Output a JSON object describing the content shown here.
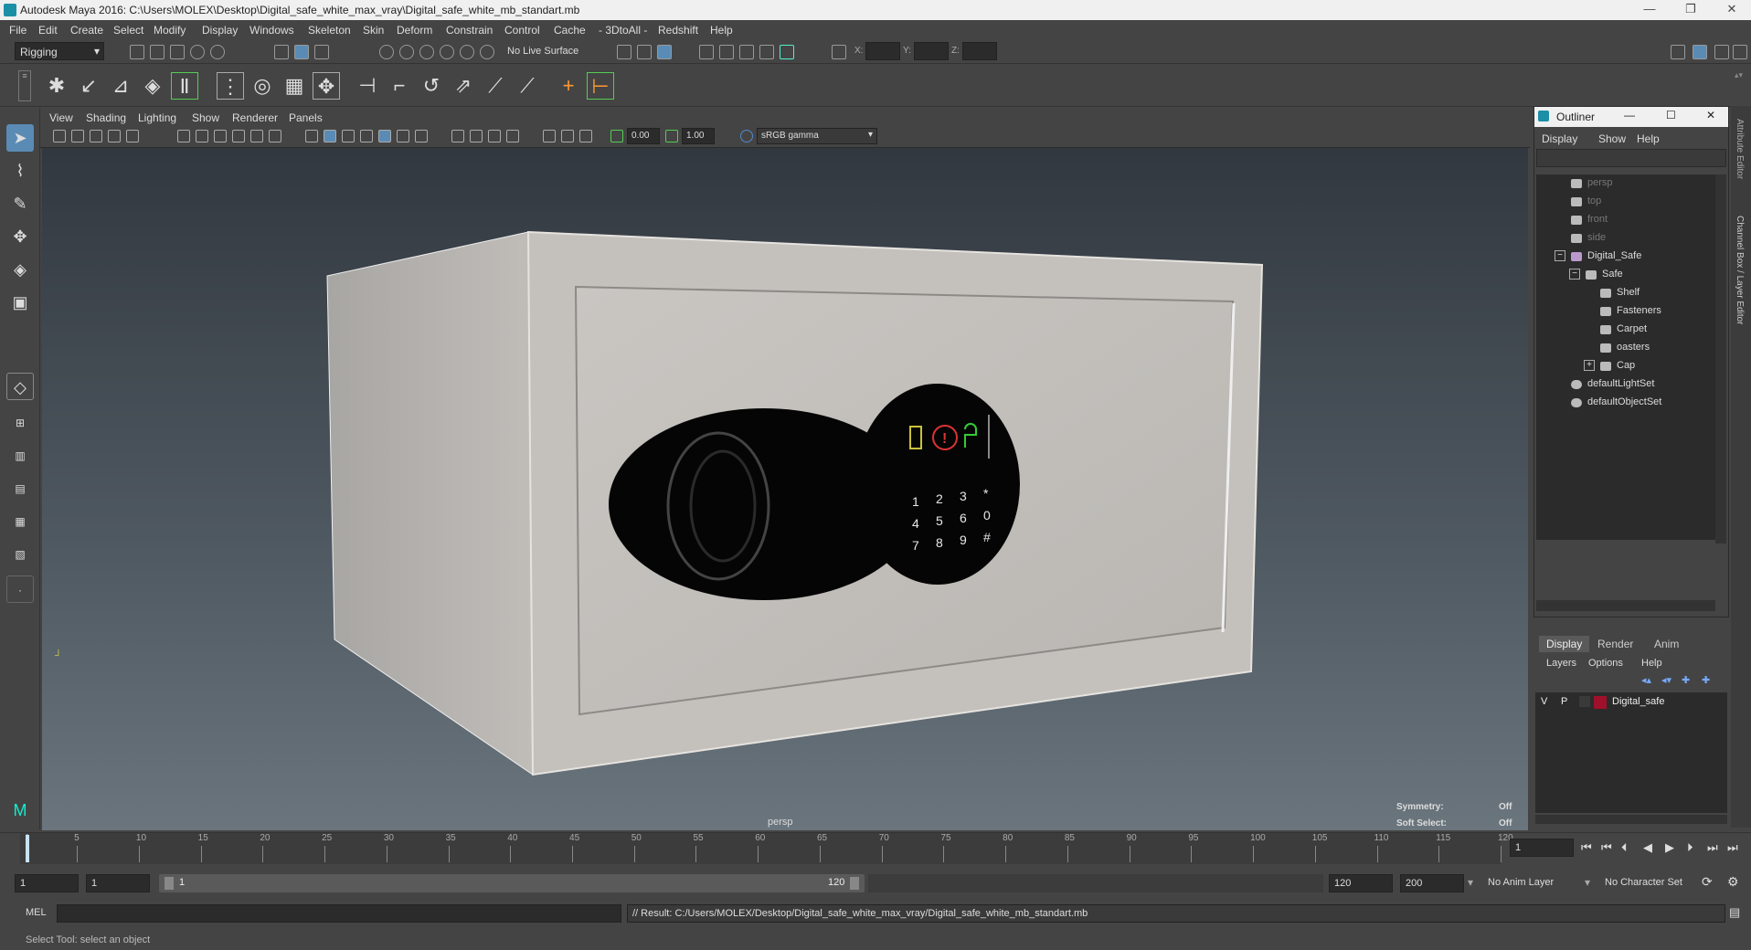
{
  "window": {
    "title": "Autodesk Maya 2016: C:\\Users\\MOLEX\\Desktop\\Digital_safe_white_max_vray\\Digital_safe_white_mb_standart.mb",
    "controls": [
      "—",
      "❐",
      "✕"
    ]
  },
  "menu": [
    "File",
    "Edit",
    "Create",
    "Select",
    "Modify",
    "Display",
    "Windows",
    "Skeleton",
    "Skin",
    "Deform",
    "Constrain",
    "Control",
    "Cache",
    "- 3DtoAll -",
    "Redshift",
    "Help"
  ],
  "toolbar": {
    "mode": "Rigging",
    "live_surface": "No Live Surface",
    "x_label": "X:",
    "y_label": "Y:",
    "z_label": "Z:"
  },
  "panel_menu": [
    "View",
    "Shading",
    "Lighting",
    "Show",
    "Renderer",
    "Panels"
  ],
  "panel_toolbar": {
    "gamma_value1": "0.00",
    "gamma_value2": "1.00",
    "colorspace": "sRGB gamma"
  },
  "viewport": {
    "camera": "persp",
    "symmetry_label": "Symmetry:",
    "symmetry_value": "Off",
    "soft_select_label": "Soft Select:",
    "soft_select_value": "Off",
    "keypad": [
      "1",
      "2",
      "3",
      "*",
      "4",
      "5",
      "6",
      "0",
      "7",
      "8",
      "9",
      "#"
    ]
  },
  "outliner": {
    "title": "Outliner",
    "menu": [
      "Display",
      "Show",
      "Help"
    ],
    "items": [
      {
        "label": "persp",
        "dim": true,
        "indent": 0,
        "icon": "camera-icon"
      },
      {
        "label": "top",
        "dim": true,
        "indent": 0,
        "icon": "camera-icon"
      },
      {
        "label": "front",
        "dim": true,
        "indent": 0,
        "icon": "camera-icon"
      },
      {
        "label": "side",
        "dim": true,
        "indent": 0,
        "icon": "camera-icon"
      },
      {
        "label": "Digital_Safe",
        "dim": false,
        "indent": 0,
        "icon": "joint-icon",
        "expander": "−"
      },
      {
        "label": "Safe",
        "dim": false,
        "indent": 1,
        "icon": "group-icon",
        "expander": "−"
      },
      {
        "label": "Shelf",
        "dim": false,
        "indent": 2,
        "icon": "mesh-icon"
      },
      {
        "label": "Fasteners",
        "dim": false,
        "indent": 2,
        "icon": "mesh-icon"
      },
      {
        "label": "Carpet",
        "dim": false,
        "indent": 2,
        "icon": "mesh-icon"
      },
      {
        "label": "oasters",
        "dim": false,
        "indent": 2,
        "icon": "mesh-icon"
      },
      {
        "label": "Cap",
        "dim": false,
        "indent": 2,
        "icon": "mesh-icon",
        "expander": "+"
      },
      {
        "label": "defaultLightSet",
        "dim": false,
        "indent": 0,
        "icon": "set-icon"
      },
      {
        "label": "defaultObjectSet",
        "dim": false,
        "indent": 0,
        "icon": "set-icon"
      }
    ]
  },
  "layer_panel": {
    "tabs": [
      "Display",
      "Render",
      "Anim"
    ],
    "menu": [
      "Layers",
      "Options",
      "Help"
    ],
    "layer": {
      "v": "V",
      "p": "P",
      "name": "Digital_safe",
      "color": "#a0102a"
    }
  },
  "side_tabs": [
    "Attribute Editor",
    "Channel Box / Layer Editor"
  ],
  "timeline": {
    "ticks": [
      "1",
      "5",
      "10",
      "15",
      "20",
      "25",
      "30",
      "35",
      "40",
      "45",
      "50",
      "55",
      "60",
      "65",
      "70",
      "75",
      "80",
      "85",
      "90",
      "95",
      "100",
      "105",
      "110",
      "115",
      "120"
    ],
    "current_frame": "1"
  },
  "range": {
    "start": "1",
    "playback_start": "1",
    "slider_start": "1",
    "slider_end": "120",
    "playback_end": "120",
    "end": "200",
    "anim_layer": "No Anim Layer",
    "character_set": "No Character Set"
  },
  "command": {
    "lang": "MEL",
    "result": "// Result: C:/Users/MOLEX/Desktop/Digital_safe_white_max_vray/Digital_safe_white_mb_standart.mb"
  },
  "help_line": "Select Tool: select an object"
}
